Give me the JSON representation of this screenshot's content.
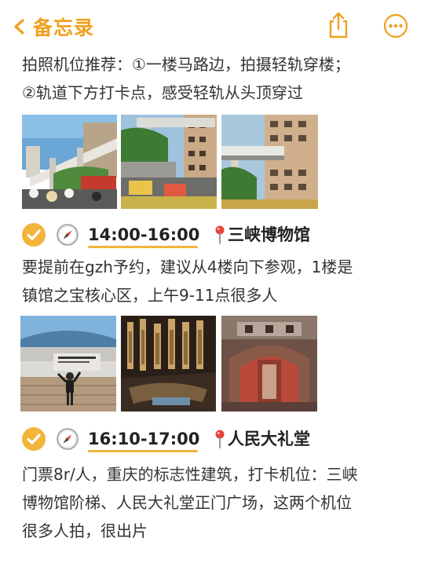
{
  "nav": {
    "back_label": "备忘录",
    "accent": "#f0a020"
  },
  "note": {
    "intro": {
      "lines": [
        "拍照机位推荐：①一楼马路边，拍摄轻轨穿楼；",
        "②轨道下方打卡点，感受轻轨从头顶穿过"
      ]
    },
    "stop1": {
      "time": "14:00-16:00",
      "place": "三峡博物馆",
      "lines": [
        "要提前在gzh予约，建议从4楼向下参观，1楼是",
        "镇馆之宝核心区，上午9-11点很多人"
      ]
    },
    "stop2": {
      "time": "16:10-17:00",
      "place": "人民大礼堂",
      "lines": [
        "门票8r/人，重庆的标志性建筑，打卡机位：三峡",
        "博物馆阶梯、人民大礼堂正门广场，这两个机位",
        "很多人拍，很出片"
      ]
    }
  },
  "photo_names": [
    "light-rail-through-building-photo",
    "light-rail-street-photo",
    "light-rail-building-closeup-photo",
    "museum-entrance-photo",
    "museum-exhibit-hall-photo",
    "museum-cave-relic-photo"
  ]
}
